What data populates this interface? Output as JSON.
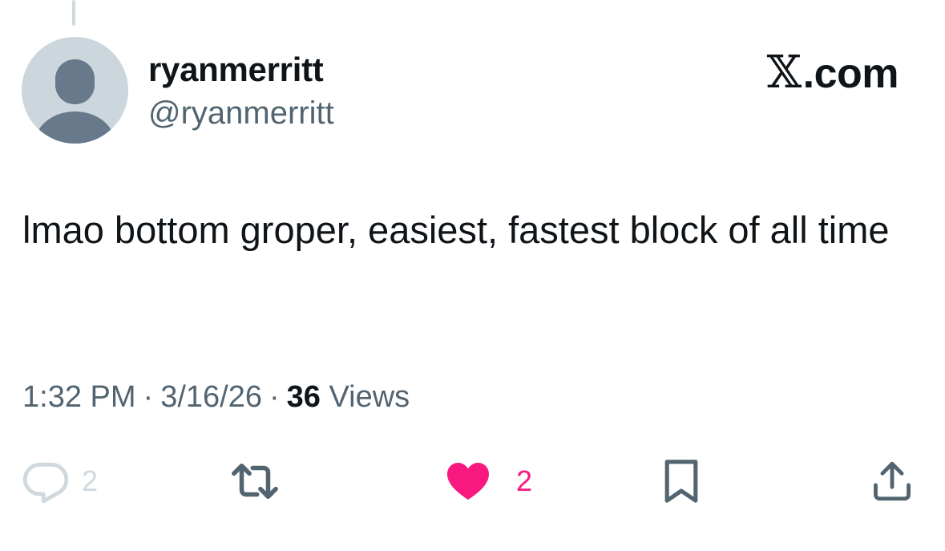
{
  "user": {
    "display_name": "ryanmerritt",
    "handle": "@ryanmerritt"
  },
  "brand": {
    "x_mark": "𝕏",
    "suffix": ".com"
  },
  "tweet": {
    "text": "lmao bottom groper, easiest, fastest block of all time"
  },
  "meta": {
    "time": "1:32 PM",
    "date": "3/16/26",
    "separator": "·",
    "views_count": "36",
    "views_label": "Views"
  },
  "actions": {
    "reply": {
      "icon": "reply-icon",
      "count": "2"
    },
    "retweet": {
      "icon": "retweet-icon"
    },
    "like": {
      "icon": "heart-icon",
      "count": "2",
      "liked": true,
      "color": "#f91880"
    },
    "bookmark": {
      "icon": "bookmark-icon"
    },
    "share": {
      "icon": "share-icon"
    }
  },
  "colors": {
    "text_primary": "#0f1419",
    "text_secondary": "#536471",
    "avatar_bg": "#ccd6dd",
    "avatar_fg": "#67798a",
    "like": "#f91880",
    "muted": "#cfd9de"
  }
}
